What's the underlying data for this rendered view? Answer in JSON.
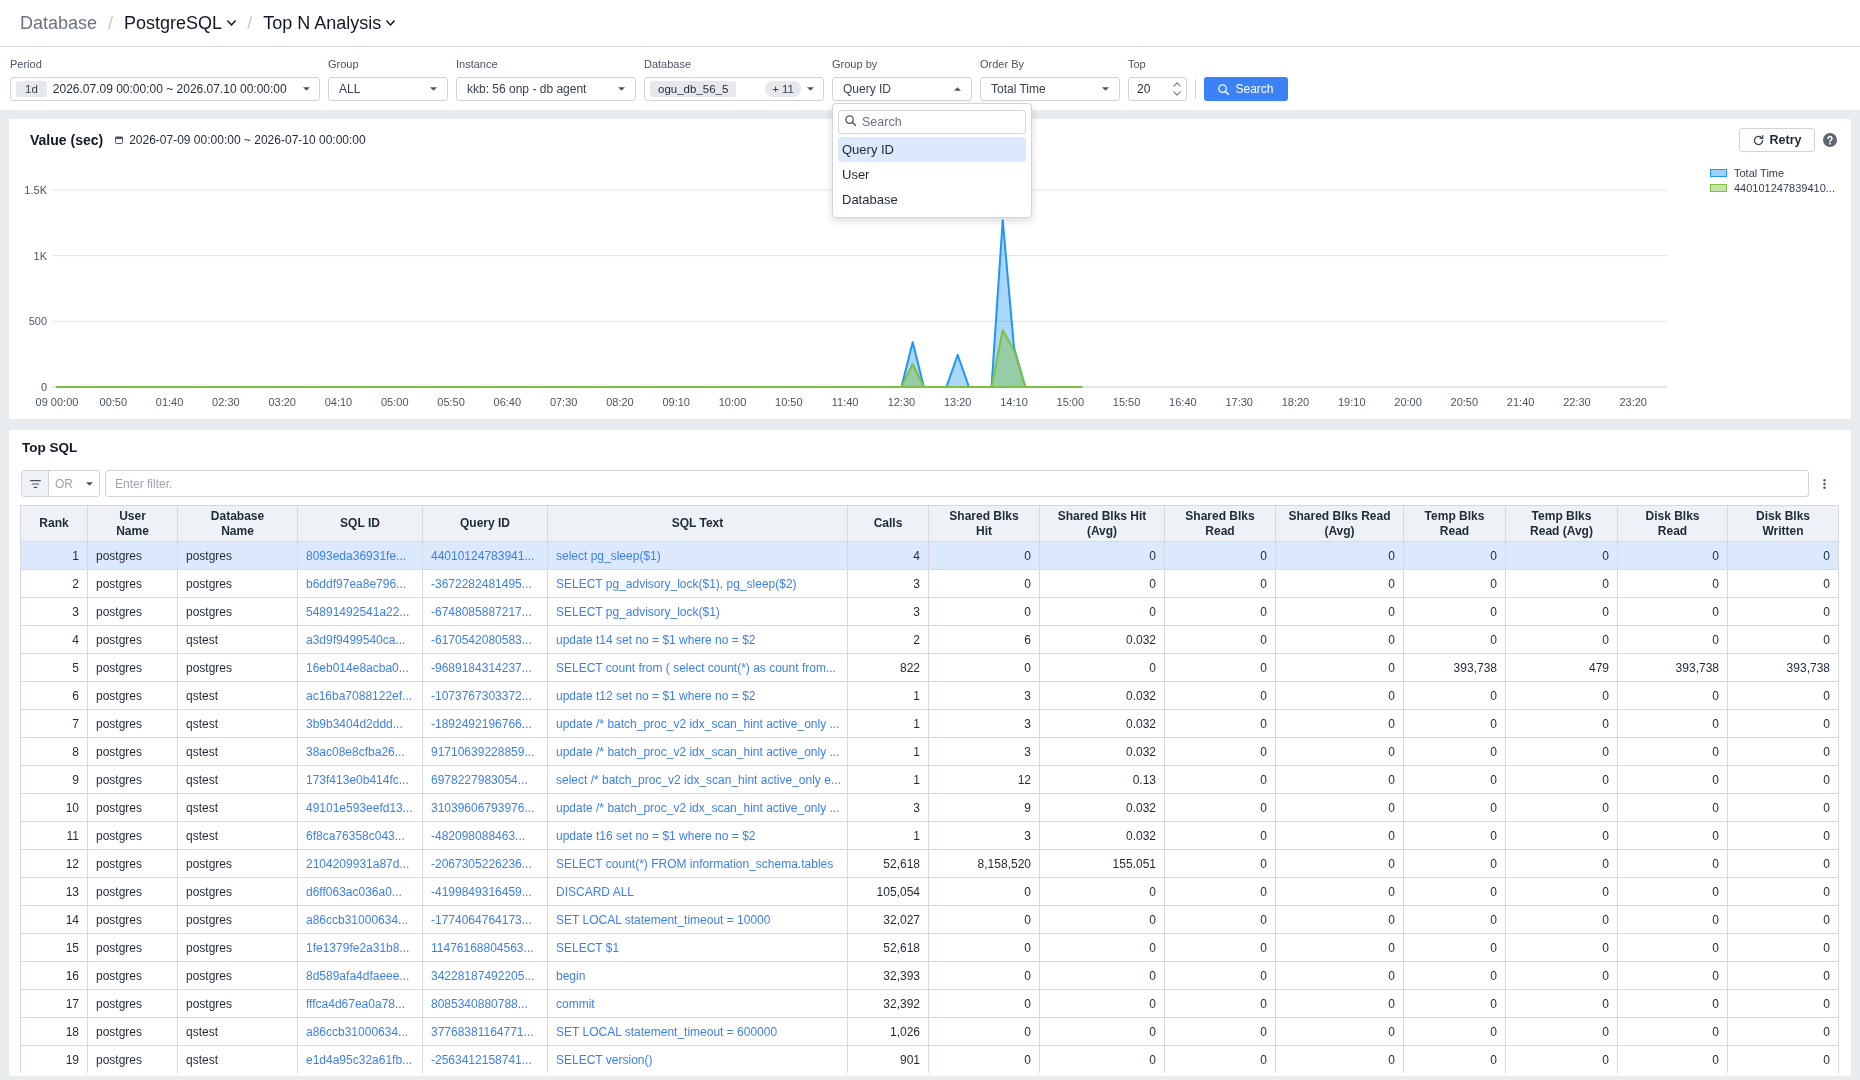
{
  "breadcrumb": [
    {
      "label": "Database",
      "kind": "link"
    },
    {
      "label": "PostgreSQL",
      "kind": "menu",
      "separator": "/"
    },
    {
      "label": "Top N Analysis",
      "kind": "menu",
      "separator": "/"
    }
  ],
  "filters": [
    {
      "kind": "period",
      "label": "Period",
      "badge": "1d",
      "value": "2026.07.09 00:00:00 ~ 2026.07.10 00:00:00",
      "expanded": false
    },
    {
      "kind": "select",
      "label": "Group",
      "value": "ALL",
      "expanded": false
    },
    {
      "kind": "select",
      "label": "Instance",
      "value": "kkb: 56 onp - db agent",
      "expanded": false
    },
    {
      "kind": "tags",
      "label": "Database",
      "tag": "ogu_db_56_5",
      "more": "+ 11",
      "expanded": false
    },
    {
      "kind": "select",
      "label": "Group by",
      "value": "Query ID",
      "expanded": true,
      "menu": {
        "placeholder": "Search",
        "options": [
          {
            "label": "Query ID",
            "selected": true
          },
          {
            "label": "User",
            "selected": false
          },
          {
            "label": "Database",
            "selected": false
          }
        ]
      }
    },
    {
      "kind": "select",
      "label": "Order By",
      "value": "Total Time",
      "expanded": false
    },
    {
      "kind": "number",
      "label": "Top",
      "value": "20"
    }
  ],
  "search_button": {
    "label": "Search"
  },
  "chart_panel": {
    "title": "Value (sec)",
    "range": "2026-07-09 00:00:00 ~ 2026-07-10 00:00:00",
    "retry_button": "Retry",
    "chart_data": {
      "type": "area",
      "legend": "right",
      "x": [
        0,
        750,
        760,
        770,
        790,
        800,
        810,
        830,
        840,
        850,
        860,
        910
      ],
      "xlim": [
        0,
        1430
      ],
      "ylim": [
        0,
        1500
      ],
      "xticks": [
        {
          "value": 0,
          "label": "09 00:00"
        },
        {
          "value": 50,
          "label": "00:50"
        },
        {
          "value": 100,
          "label": "01:40"
        },
        {
          "value": 150,
          "label": "02:30"
        },
        {
          "value": 200,
          "label": "03:20"
        },
        {
          "value": 250,
          "label": "04:10"
        },
        {
          "value": 300,
          "label": "05:00"
        },
        {
          "value": 350,
          "label": "05:50"
        },
        {
          "value": 400,
          "label": "06:40"
        },
        {
          "value": 450,
          "label": "07:30"
        },
        {
          "value": 500,
          "label": "08:20"
        },
        {
          "value": 550,
          "label": "09:10"
        },
        {
          "value": 600,
          "label": "10:00"
        },
        {
          "value": 650,
          "label": "10:50"
        },
        {
          "value": 700,
          "label": "11:40"
        },
        {
          "value": 750,
          "label": "12:30"
        },
        {
          "value": 800,
          "label": "13:20"
        },
        {
          "value": 850,
          "label": "14:10"
        },
        {
          "value": 900,
          "label": "15:00"
        },
        {
          "value": 950,
          "label": "15:50"
        },
        {
          "value": 1000,
          "label": "16:40"
        },
        {
          "value": 1050,
          "label": "17:30"
        },
        {
          "value": 1100,
          "label": "18:20"
        },
        {
          "value": 1150,
          "label": "19:10"
        },
        {
          "value": 1200,
          "label": "20:00"
        },
        {
          "value": 1250,
          "label": "20:50"
        },
        {
          "value": 1300,
          "label": "21:40"
        },
        {
          "value": 1350,
          "label": "22:30"
        },
        {
          "value": 1400,
          "label": "23:20"
        }
      ],
      "yticks": [
        {
          "value": 0,
          "label": "0"
        },
        {
          "value": 500,
          "label": "500"
        },
        {
          "value": 1000,
          "label": "1K"
        },
        {
          "value": 1500,
          "label": "1.5K"
        }
      ],
      "series": [
        {
          "name": "Total Time",
          "color": "#2196f3",
          "values": [
            0,
            0,
            340,
            0,
            0,
            245,
            0,
            0,
            1270,
            300,
            0,
            0
          ]
        },
        {
          "name": "440101247839410...",
          "color": "#7cc242",
          "values": [
            0,
            0,
            175,
            0,
            0,
            0,
            0,
            0,
            432,
            280,
            0,
            0
          ]
        }
      ]
    }
  },
  "top_sql": {
    "title": "Top SQL",
    "filter": {
      "operator": "OR",
      "placeholder": "Enter filter."
    },
    "table": {
      "columns": [
        {
          "label": "Rank",
          "kind": "number"
        },
        {
          "label": "User Name",
          "kind": "text"
        },
        {
          "label": "Database Name",
          "kind": "text"
        },
        {
          "label": "SQL ID",
          "kind": "link"
        },
        {
          "label": "Query ID",
          "kind": "link"
        },
        {
          "label": "SQL Text",
          "kind": "link"
        },
        {
          "label": "Calls",
          "kind": "number"
        },
        {
          "label": "Shared Blks Hit",
          "kind": "number"
        },
        {
          "label": "Shared Blks Hit (Avg)",
          "kind": "number"
        },
        {
          "label": "Shared Blks Read",
          "kind": "number"
        },
        {
          "label": "Shared Blks Read (Avg)",
          "kind": "number"
        },
        {
          "label": "Temp Blks Read",
          "kind": "number"
        },
        {
          "label": "Temp Blks Read (Avg)",
          "kind": "number"
        },
        {
          "label": "Disk Blks Read",
          "kind": "number"
        },
        {
          "label": "Disk Blks Written",
          "kind": "number"
        }
      ],
      "rows": [
        {
          "selected": true,
          "cells": [
            "1",
            "postgres",
            "postgres",
            "8093eda36931fe...",
            "44010124783941...",
            "select pg_sleep($1)",
            "4",
            "0",
            "0",
            "0",
            "0",
            "0",
            "0",
            "0",
            "0"
          ]
        },
        {
          "selected": false,
          "cells": [
            "2",
            "postgres",
            "postgres",
            "b6ddf97ea8e796...",
            "-3672282481495...",
            "SELECT pg_advisory_lock($1), pg_sleep($2)",
            "3",
            "0",
            "0",
            "0",
            "0",
            "0",
            "0",
            "0",
            "0"
          ]
        },
        {
          "selected": false,
          "cells": [
            "3",
            "postgres",
            "postgres",
            "54891492541a22...",
            "-6748085887217...",
            "SELECT pg_advisory_lock($1)",
            "3",
            "0",
            "0",
            "0",
            "0",
            "0",
            "0",
            "0",
            "0"
          ]
        },
        {
          "selected": false,
          "cells": [
            "4",
            "postgres",
            "qstest",
            "a3d9f9499540ca...",
            "-6170542080583...",
            "update t14 set no = $1 where no = $2",
            "2",
            "6",
            "0.032",
            "0",
            "0",
            "0",
            "0",
            "0",
            "0"
          ]
        },
        {
          "selected": false,
          "cells": [
            "5",
            "postgres",
            "postgres",
            "16eb014e8acba0...",
            "-9689184314237...",
            "SELECT count from ( select count(*) as count from...",
            "822",
            "0",
            "0",
            "0",
            "0",
            "393,738",
            "479",
            "393,738",
            "393,738"
          ]
        },
        {
          "selected": false,
          "cells": [
            "6",
            "postgres",
            "qstest",
            "ac16ba7088122ef...",
            "-1073767303372...",
            "update t12 set no = $1 where no = $2",
            "1",
            "3",
            "0.032",
            "0",
            "0",
            "0",
            "0",
            "0",
            "0"
          ]
        },
        {
          "selected": false,
          "cells": [
            "7",
            "postgres",
            "qstest",
            "3b9b3404d2ddd...",
            "-1892492196766...",
            "update /* batch_proc_v2 idx_scan_hint active_only ...",
            "1",
            "3",
            "0.032",
            "0",
            "0",
            "0",
            "0",
            "0",
            "0"
          ]
        },
        {
          "selected": false,
          "cells": [
            "8",
            "postgres",
            "qstest",
            "38ac08e8cfba26...",
            "91710639228859...",
            "update /* batch_proc_v2 idx_scan_hint active_only ...",
            "1",
            "3",
            "0.032",
            "0",
            "0",
            "0",
            "0",
            "0",
            "0"
          ]
        },
        {
          "selected": false,
          "cells": [
            "9",
            "postgres",
            "qstest",
            "173f413e0b414fc...",
            "6978227983054...",
            "select /* batch_proc_v2 idx_scan_hint active_only e...",
            "1",
            "12",
            "0.13",
            "0",
            "0",
            "0",
            "0",
            "0",
            "0"
          ]
        },
        {
          "selected": false,
          "cells": [
            "10",
            "postgres",
            "qstest",
            "49101e593eefd13...",
            "31039606793976...",
            "update /* batch_proc_v2 idx_scan_hint active_only ...",
            "3",
            "9",
            "0.032",
            "0",
            "0",
            "0",
            "0",
            "0",
            "0"
          ]
        },
        {
          "selected": false,
          "cells": [
            "11",
            "postgres",
            "qstest",
            "6f8ca76358c043...",
            "-482098088463...",
            "update t16 set no = $1 where no = $2",
            "1",
            "3",
            "0.032",
            "0",
            "0",
            "0",
            "0",
            "0",
            "0"
          ]
        },
        {
          "selected": false,
          "cells": [
            "12",
            "postgres",
            "postgres",
            "2104209931a87d...",
            "-2067305226236...",
            "SELECT count(*) FROM information_schema.tables",
            "52,618",
            "8,158,520",
            "155.051",
            "0",
            "0",
            "0",
            "0",
            "0",
            "0"
          ]
        },
        {
          "selected": false,
          "cells": [
            "13",
            "postgres",
            "postgres",
            "d6ff063ac036a0...",
            "-4199849316459...",
            "DISCARD ALL",
            "105,054",
            "0",
            "0",
            "0",
            "0",
            "0",
            "0",
            "0",
            "0"
          ]
        },
        {
          "selected": false,
          "cells": [
            "14",
            "postgres",
            "postgres",
            "a86ccb31000634...",
            "-1774064764173...",
            "SET LOCAL statement_timeout = 10000",
            "32,027",
            "0",
            "0",
            "0",
            "0",
            "0",
            "0",
            "0",
            "0"
          ]
        },
        {
          "selected": false,
          "cells": [
            "15",
            "postgres",
            "postgres",
            "1fe1379fe2a31b8...",
            "11476168804563...",
            "SELECT $1",
            "52,618",
            "0",
            "0",
            "0",
            "0",
            "0",
            "0",
            "0",
            "0"
          ]
        },
        {
          "selected": false,
          "cells": [
            "16",
            "postgres",
            "postgres",
            "8d589afa4dfaeee...",
            "34228187492205...",
            "begin",
            "32,393",
            "0",
            "0",
            "0",
            "0",
            "0",
            "0",
            "0",
            "0"
          ]
        },
        {
          "selected": false,
          "cells": [
            "17",
            "postgres",
            "postgres",
            "fffca4d67ea0a78...",
            "8085340880788...",
            "commit",
            "32,392",
            "0",
            "0",
            "0",
            "0",
            "0",
            "0",
            "0",
            "0"
          ]
        },
        {
          "selected": false,
          "cells": [
            "18",
            "postgres",
            "qstest",
            "a86ccb31000634...",
            "37768381164771...",
            "SET LOCAL statement_timeout = 600000",
            "1,026",
            "0",
            "0",
            "0",
            "0",
            "0",
            "0",
            "0",
            "0"
          ]
        },
        {
          "selected": false,
          "cells": [
            "19",
            "postgres",
            "qstest",
            "e1d4a95c32a61fb...",
            "-2563412158741...",
            "SELECT version()",
            "901",
            "0",
            "0",
            "0",
            "0",
            "0",
            "0",
            "0",
            "0"
          ]
        }
      ]
    }
  }
}
